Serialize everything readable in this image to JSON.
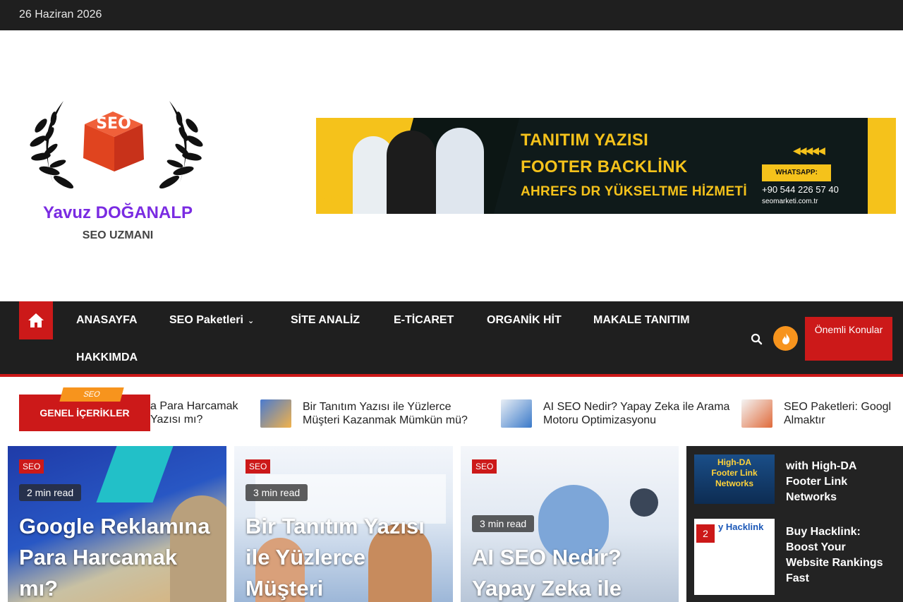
{
  "topbar": {
    "date": "26 Haziran 2026"
  },
  "header": {
    "logo": {
      "logo_text": "SEO",
      "brand": "Yavuz DOĞANALP",
      "tagline": "SEO UZMANI"
    },
    "banner": {
      "lines": [
        "TANITIM YAZISI",
        "FOOTER BACKLİNK",
        "AHREFS DR YÜKSELTME HİZMETİ"
      ],
      "whatsapp_label": "WHATSAPP:",
      "phone": "+90 544 226 57 40",
      "site": "seomarketi.com.tr"
    }
  },
  "nav": {
    "items": [
      {
        "label": "ANASAYFA"
      },
      {
        "label": "SEO Paketleri"
      },
      {
        "label": "SİTE ANALİZ"
      },
      {
        "label": "E-TİCARET"
      },
      {
        "label": "ORGANİK HİT"
      },
      {
        "label": "MAKALE TANITIM"
      },
      {
        "label": "HAKKIMDA"
      }
    ],
    "featured_button": "Önemli Konular"
  },
  "ticker": {
    "tag": "SEO",
    "label": "GENEL İÇERİKLER",
    "items": [
      {
        "text": "a Para Harcamak\nYazısı mı?"
      },
      {
        "text": "Bir Tanıtım Yazısı ile Yüzlerce\nMüşteri Kazanmak Mümkün mü?"
      },
      {
        "text": "AI SEO Nedir? Yapay Zeka ile Arama\nMotoru Optimizasyonu"
      },
      {
        "text": "SEO Paketleri: Googl\nAlmaktır"
      }
    ]
  },
  "cards": [
    {
      "badge": "SEO",
      "readtime": "2 min read",
      "title": "Google Reklamına Para Harcamak mı?"
    },
    {
      "badge": "SEO",
      "readtime": "3 min read",
      "title": "Bir Tanıtım Yazısı ile Yüzlerce Müşteri"
    },
    {
      "badge": "SEO",
      "readtime": "3 min read",
      "title": "AI SEO Nedir? Yapay Zeka ile"
    }
  ],
  "sidebar": {
    "items": [
      {
        "title": "with High-DA Footer Link Networks",
        "thumb_text": "High-DA\nFooter Link Networks"
      },
      {
        "num": "2",
        "title": "Buy Hacklink: Boost Your Website Rankings Fast",
        "thumb_text": "y Hacklink"
      }
    ]
  },
  "colors": {
    "accent": "#cc1919",
    "dark": "#1f1f1f",
    "orange": "#f7941d",
    "banner_yellow": "#f5c21b",
    "brand_purple": "#7a2be2"
  }
}
